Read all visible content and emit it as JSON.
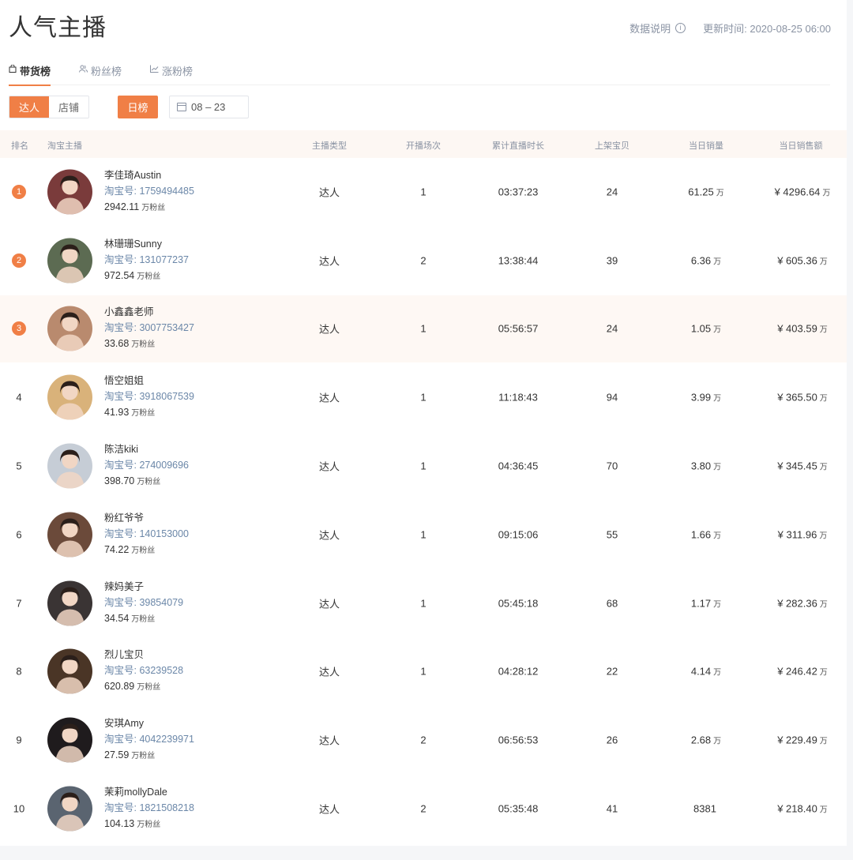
{
  "header": {
    "title": "人气主播",
    "data_note": "数据说明",
    "update_time": "更新时间: 2020-08-25 06:00"
  },
  "tabs": [
    {
      "label": "带货榜",
      "icon": "bag-icon",
      "active": true
    },
    {
      "label": "粉丝榜",
      "icon": "users-icon",
      "active": false
    },
    {
      "label": "涨粉榜",
      "icon": "chart-line-icon",
      "active": false
    }
  ],
  "filters": {
    "type_options": [
      "达人",
      "店铺"
    ],
    "period": "日榜",
    "date": "08 – 23"
  },
  "table": {
    "columns": [
      "排名",
      "淘宝主播",
      "主播类型",
      "开播场次",
      "累计直播时长",
      "上架宝贝",
      "当日销量",
      "当日销售额"
    ],
    "fans_unit": "万粉丝",
    "wan_unit": "万",
    "rows": [
      {
        "rank": "1",
        "name": "李佳琦Austin",
        "taobao": "淘宝号: 1759494485",
        "fans": "2942.11",
        "type": "达人",
        "sessions": "1",
        "duration": "03:37:23",
        "items": "24",
        "sales": "61.25",
        "sales_unit": "万",
        "revenue": "¥ 4296.64",
        "revenue_unit": "万",
        "avatar_color": "#7a3b3b"
      },
      {
        "rank": "2",
        "name": "林珊珊Sunny",
        "taobao": "淘宝号: 131077237",
        "fans": "972.54",
        "type": "达人",
        "sessions": "2",
        "duration": "13:38:44",
        "items": "39",
        "sales": "6.36",
        "sales_unit": "万",
        "revenue": "¥ 605.36",
        "revenue_unit": "万",
        "avatar_color": "#5c6b52"
      },
      {
        "rank": "3",
        "name": "小鑫鑫老师",
        "taobao": "淘宝号: 3007753427",
        "fans": "33.68",
        "type": "达人",
        "sessions": "1",
        "duration": "05:56:57",
        "items": "24",
        "sales": "1.05",
        "sales_unit": "万",
        "revenue": "¥ 403.59",
        "revenue_unit": "万",
        "avatar_color": "#b98a6e"
      },
      {
        "rank": "4",
        "name": "悟空姐姐",
        "taobao": "淘宝号: 3918067539",
        "fans": "41.93",
        "type": "达人",
        "sessions": "1",
        "duration": "11:18:43",
        "items": "94",
        "sales": "3.99",
        "sales_unit": "万",
        "revenue": "¥ 365.50",
        "revenue_unit": "万",
        "avatar_color": "#d9b27a"
      },
      {
        "rank": "5",
        "name": "陈洁kiki",
        "taobao": "淘宝号: 274009696",
        "fans": "398.70",
        "type": "达人",
        "sessions": "1",
        "duration": "04:36:45",
        "items": "70",
        "sales": "3.80",
        "sales_unit": "万",
        "revenue": "¥ 345.45",
        "revenue_unit": "万",
        "avatar_color": "#c6cdd6"
      },
      {
        "rank": "6",
        "name": "粉红爷爷",
        "taobao": "淘宝号: 140153000",
        "fans": "74.22",
        "type": "达人",
        "sessions": "1",
        "duration": "09:15:06",
        "items": "55",
        "sales": "1.66",
        "sales_unit": "万",
        "revenue": "¥ 311.96",
        "revenue_unit": "万",
        "avatar_color": "#6b4a3a"
      },
      {
        "rank": "7",
        "name": "辣妈美子",
        "taobao": "淘宝号: 39854079",
        "fans": "34.54",
        "type": "达人",
        "sessions": "1",
        "duration": "05:45:18",
        "items": "68",
        "sales": "1.17",
        "sales_unit": "万",
        "revenue": "¥ 282.36",
        "revenue_unit": "万",
        "avatar_color": "#3a3434"
      },
      {
        "rank": "8",
        "name": "烈儿宝贝",
        "taobao": "淘宝号: 63239528",
        "fans": "620.89",
        "type": "达人",
        "sessions": "1",
        "duration": "04:28:12",
        "items": "22",
        "sales": "4.14",
        "sales_unit": "万",
        "revenue": "¥ 246.42",
        "revenue_unit": "万",
        "avatar_color": "#4a3526"
      },
      {
        "rank": "9",
        "name": "安琪Amy",
        "taobao": "淘宝号: 4042239971",
        "fans": "27.59",
        "type": "达人",
        "sessions": "2",
        "duration": "06:56:53",
        "items": "26",
        "sales": "2.68",
        "sales_unit": "万",
        "revenue": "¥ 229.49",
        "revenue_unit": "万",
        "avatar_color": "#1f1b1d"
      },
      {
        "rank": "10",
        "name": "茉莉mollyDale",
        "taobao": "淘宝号: 1821508218",
        "fans": "104.13",
        "type": "达人",
        "sessions": "2",
        "duration": "05:35:48",
        "items": "41",
        "sales": "8381",
        "sales_unit": "",
        "revenue": "¥ 218.40",
        "revenue_unit": "万",
        "avatar_color": "#5a6470"
      }
    ]
  },
  "colors": {
    "accent": "#f07f46",
    "link": "#6b87a8",
    "muted": "#8a93a3",
    "row_highlight": "#fef8f4"
  }
}
